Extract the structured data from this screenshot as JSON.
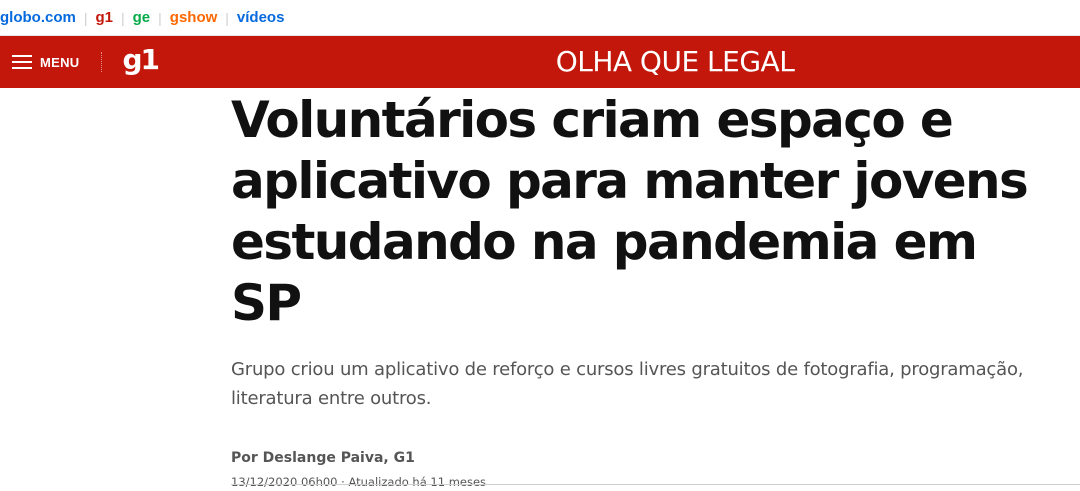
{
  "globo_bar": {
    "links": [
      {
        "label": "globo.com",
        "color": "#0669DE"
      },
      {
        "label": "g1",
        "color": "#C4170C"
      },
      {
        "label": "ge",
        "color": "#06AA48"
      },
      {
        "label": "gshow",
        "color": "#FF6700"
      },
      {
        "label": "vídeos",
        "color": "#0669DE"
      }
    ],
    "separator": "|"
  },
  "header": {
    "background": "#C4170C",
    "menu_label": "MENU",
    "logo_text": "g1",
    "section_title": "OLHA QUE LEGAL"
  },
  "article": {
    "headline": "Voluntários criam espaço e aplicativo para manter jovens estudando na pandemia em SP",
    "subtitle": "Grupo criou um aplicativo de reforço e cursos livres gratuitos de fotografia, programação, literatura entre outros.",
    "byline": "Por Deslange Paiva, G1",
    "dateline": "13/12/2020 06h00 · Atualizado há 11 meses"
  }
}
